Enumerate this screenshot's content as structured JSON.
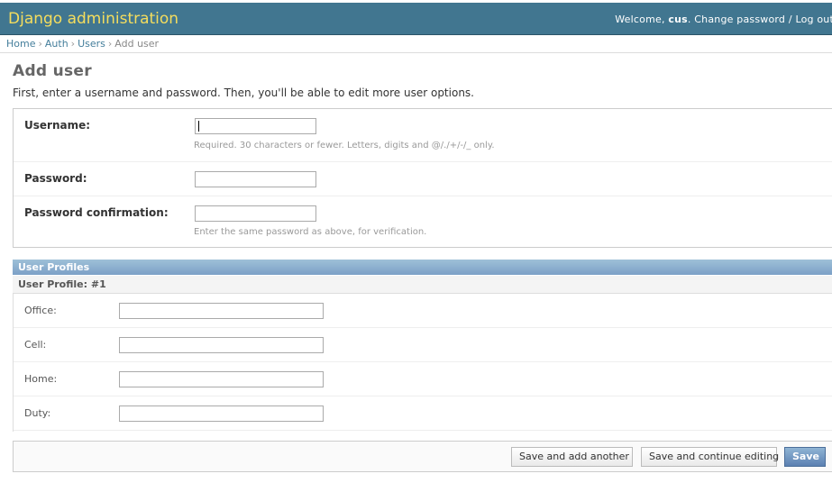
{
  "header": {
    "site_name": "Django administration",
    "welcome": "Welcome,",
    "username": "cus",
    "change_password": "Change password",
    "separator": "/",
    "logout": "Log out"
  },
  "breadcrumbs": {
    "home": "Home",
    "app": "Auth",
    "model": "Users",
    "current": "Add user",
    "sep": "›"
  },
  "page": {
    "title": "Add user",
    "intro": "First, enter a username and password. Then, you'll be able to edit more user options."
  },
  "form": {
    "username_label": "Username:",
    "username_value": "",
    "username_help": "Required. 30 characters or fewer. Letters, digits and @/./+/-/_ only.",
    "password_label": "Password:",
    "password_value": "",
    "password2_label": "Password confirmation:",
    "password2_value": "",
    "password2_help": "Enter the same password as above, for verification."
  },
  "inline": {
    "group_title": "User Profiles",
    "item_title": "User Profile: #1",
    "fields": [
      {
        "label": "Office:",
        "value": ""
      },
      {
        "label": "Cell:",
        "value": ""
      },
      {
        "label": "Home:",
        "value": ""
      },
      {
        "label": "Duty:",
        "value": ""
      }
    ]
  },
  "submit": {
    "save_add_another": "Save and add another",
    "save_continue": "Save and continue editing",
    "save": "Save"
  }
}
